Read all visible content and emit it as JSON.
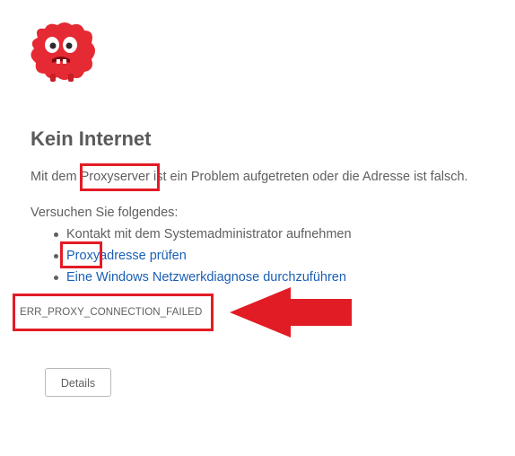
{
  "error_page": {
    "title": "Kein Internet",
    "message": {
      "before": "Mit dem ",
      "highlight": "Proxyserver",
      "after": " ist ein Problem aufgetreten oder die Adresse ist falsch."
    },
    "try_heading": "Versuchen Sie folgendes:",
    "suggestions": [
      {
        "text": "Kontakt mit dem Systemadministrator aufnehmen"
      },
      {
        "highlight": "Proxy",
        "rest": "adresse prüfen"
      },
      {
        "text": "Eine Windows Netzwerkdiagnose durchzuführen"
      }
    ],
    "error_code": "ERR_PROXY_CONNECTION_FAILED",
    "details_button": "Details"
  },
  "colors": {
    "annotation_red": "#e21c25",
    "link_blue": "#1a5fb4",
    "text_gray": "#5f5f5f"
  },
  "icons": {
    "mascot": "red-fuzzy-monster-icon",
    "arrow": "left-arrow-icon"
  }
}
